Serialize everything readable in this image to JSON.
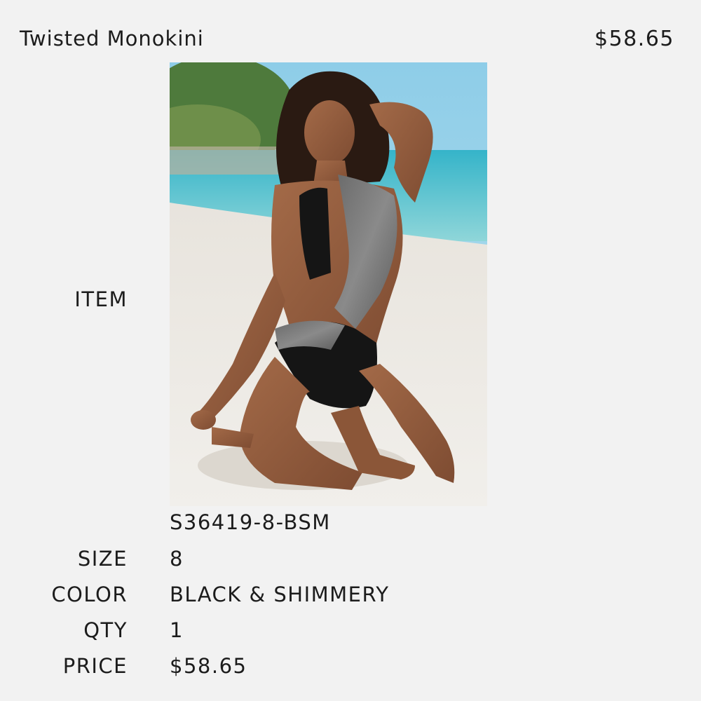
{
  "header": {
    "product_name": "Twisted Monokini",
    "product_price": "$58.65"
  },
  "item": {
    "label": "ITEM",
    "sku": "S36419-8-BSM",
    "image": "swimsuit-model-on-beach-photo"
  },
  "details": [
    {
      "label": "SIZE",
      "value": "8"
    },
    {
      "label": "COLOR",
      "value": "BLACK & SHIMMERY"
    },
    {
      "label": "QTY",
      "value": "1"
    },
    {
      "label": "PRICE",
      "value": "$58.65"
    }
  ]
}
